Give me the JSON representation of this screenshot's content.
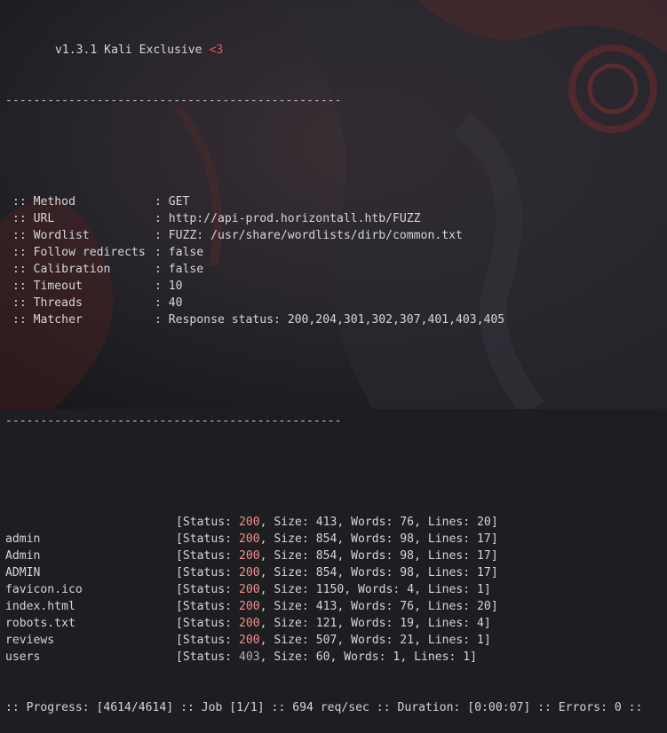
{
  "banner": {
    "version": "v1.3.1 Kali Exclusive",
    "heart": "<3"
  },
  "separator": "------------------------------------------------",
  "config": [
    {
      "key": ":: Method",
      "value": ": GET"
    },
    {
      "key": ":: URL",
      "value": ": http://api-prod.horizontall.htb/FUZZ"
    },
    {
      "key": ":: Wordlist",
      "value": ": FUZZ: /usr/share/wordlists/dirb/common.txt"
    },
    {
      "key": ":: Follow redirects",
      "value": ": false"
    },
    {
      "key": ":: Calibration",
      "value": ": false"
    },
    {
      "key": ":: Timeout",
      "value": ": 10"
    },
    {
      "key": ":: Threads",
      "value": ": 40"
    },
    {
      "key": ":: Matcher",
      "value": ": Response status: 200,204,301,302,307,401,403,405"
    }
  ],
  "results": [
    {
      "name": "",
      "status": "200",
      "size": "413",
      "words": "76",
      "lines": "20"
    },
    {
      "name": "admin",
      "status": "200",
      "size": "854",
      "words": "98",
      "lines": "17"
    },
    {
      "name": "Admin",
      "status": "200",
      "size": "854",
      "words": "98",
      "lines": "17"
    },
    {
      "name": "ADMIN",
      "status": "200",
      "size": "854",
      "words": "98",
      "lines": "17"
    },
    {
      "name": "favicon.ico",
      "status": "200",
      "size": "1150",
      "words": "4",
      "lines": "1"
    },
    {
      "name": "index.html",
      "status": "200",
      "size": "413",
      "words": "76",
      "lines": "20"
    },
    {
      "name": "robots.txt",
      "status": "200",
      "size": "121",
      "words": "19",
      "lines": "4"
    },
    {
      "name": "reviews",
      "status": "200",
      "size": "507",
      "words": "21",
      "lines": "1"
    },
    {
      "name": "users",
      "status": "403",
      "size": "60",
      "words": "1",
      "lines": "1"
    }
  ],
  "labels": {
    "status": "[Status: ",
    "size": ", Size: ",
    "words": ", Words: ",
    "lines": ", Lines: ",
    "close": "]"
  },
  "progress": ":: Progress: [4614/4614] :: Job [1/1] :: 694 req/sec :: Duration: [0:00:07] :: Errors: 0 ::",
  "colors": {
    "background": "#1d1d22",
    "text": "#d6d6d6",
    "accent_red": "#e25a5a",
    "status_200": "#f0908c"
  }
}
